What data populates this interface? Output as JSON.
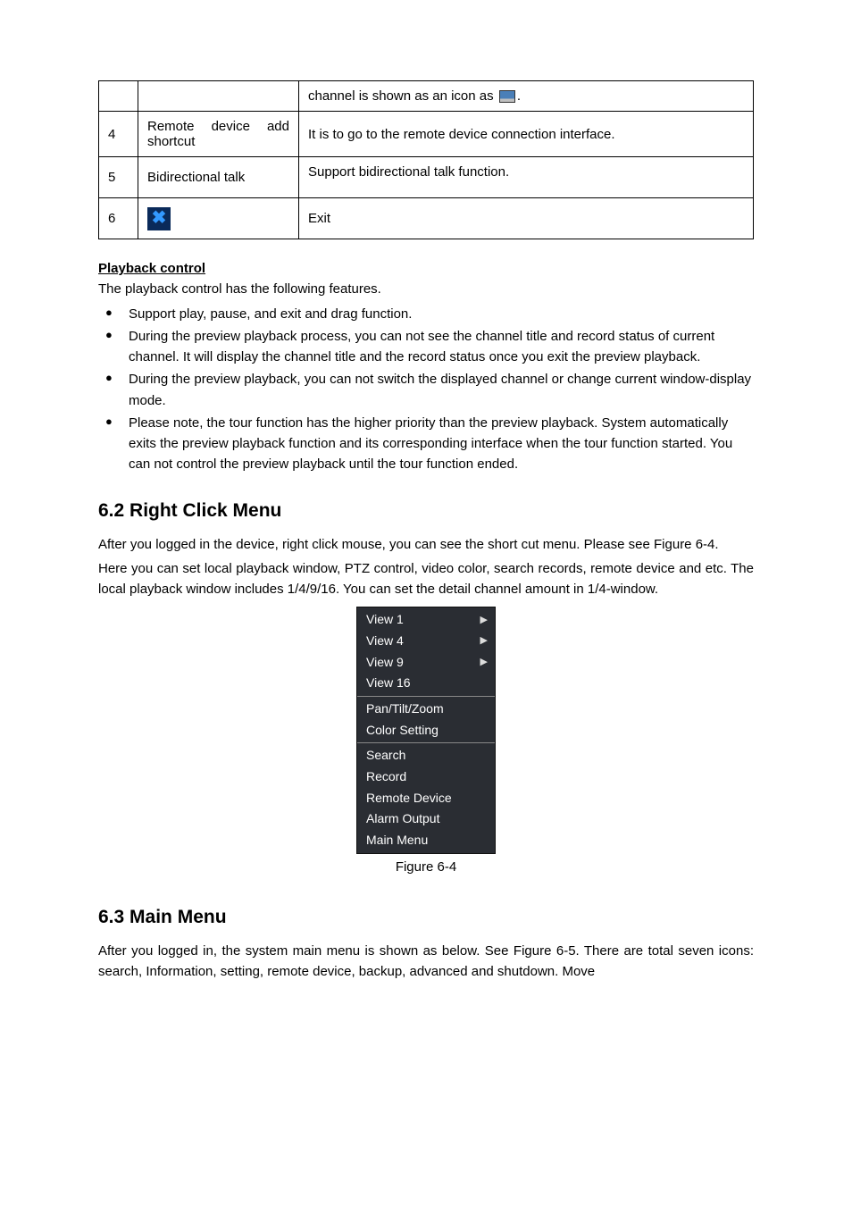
{
  "table": {
    "rows": [
      {
        "num": "",
        "label": "",
        "desc_prefix": "channel is shown as an icon as",
        "desc_suffix": "."
      },
      {
        "num": "4",
        "label": "Remote device add shortcut",
        "desc": "It is to go to the remote device connection interface."
      },
      {
        "num": "5",
        "label": "Bidirectional talk",
        "desc": "Support bidirectional talk function."
      },
      {
        "num": "6",
        "label": "",
        "desc": "Exit"
      }
    ]
  },
  "playback": {
    "title": "Playback control",
    "intro": "The playback control has the following features.",
    "bullets": [
      "Support play, pause, and exit and drag function.",
      "During the preview playback process, you can not see the channel title and record status of current channel. It will display the channel title and the record status once you exit the preview playback.",
      "During the preview playback, you can not switch the displayed channel or change current window-display mode.",
      "Please note, the tour function has the higher priority than the preview playback. System automatically exits the preview playback function and its corresponding interface when the tour function started. You can not control the preview playback until the tour function ended."
    ]
  },
  "section62": {
    "heading": "6.2  Right Click Menu",
    "para1": "After you logged in the device, right click mouse, you can see the short cut menu. Please see Figure 6-4.",
    "para2": "Here you can set local playback window, PTZ control, video color, search records, remote device and etc. The local playback window includes 1/4/9/16. You can set the detail channel amount in 1/4-window."
  },
  "context_menu": {
    "group1": [
      {
        "label": "View 1",
        "arrow": true
      },
      {
        "label": "View 4",
        "arrow": true
      },
      {
        "label": "View 9",
        "arrow": true
      },
      {
        "label": "View 16",
        "arrow": false
      }
    ],
    "group2": [
      {
        "label": "Pan/Tilt/Zoom",
        "arrow": false
      },
      {
        "label": "Color Setting",
        "arrow": false
      }
    ],
    "group3": [
      {
        "label": "Search",
        "arrow": false
      },
      {
        "label": "Record",
        "arrow": false
      },
      {
        "label": "Remote Device",
        "arrow": false
      },
      {
        "label": "Alarm Output",
        "arrow": false
      },
      {
        "label": "Main Menu",
        "arrow": false
      }
    ]
  },
  "figure_caption": "Figure 6-4",
  "section63": {
    "heading": "6.3  Main Menu",
    "para": "After you logged in, the system main menu is shown as below. See Figure 6-5. There are total seven icons: search, Information, setting, remote device, backup, advanced and shutdown. Move"
  }
}
